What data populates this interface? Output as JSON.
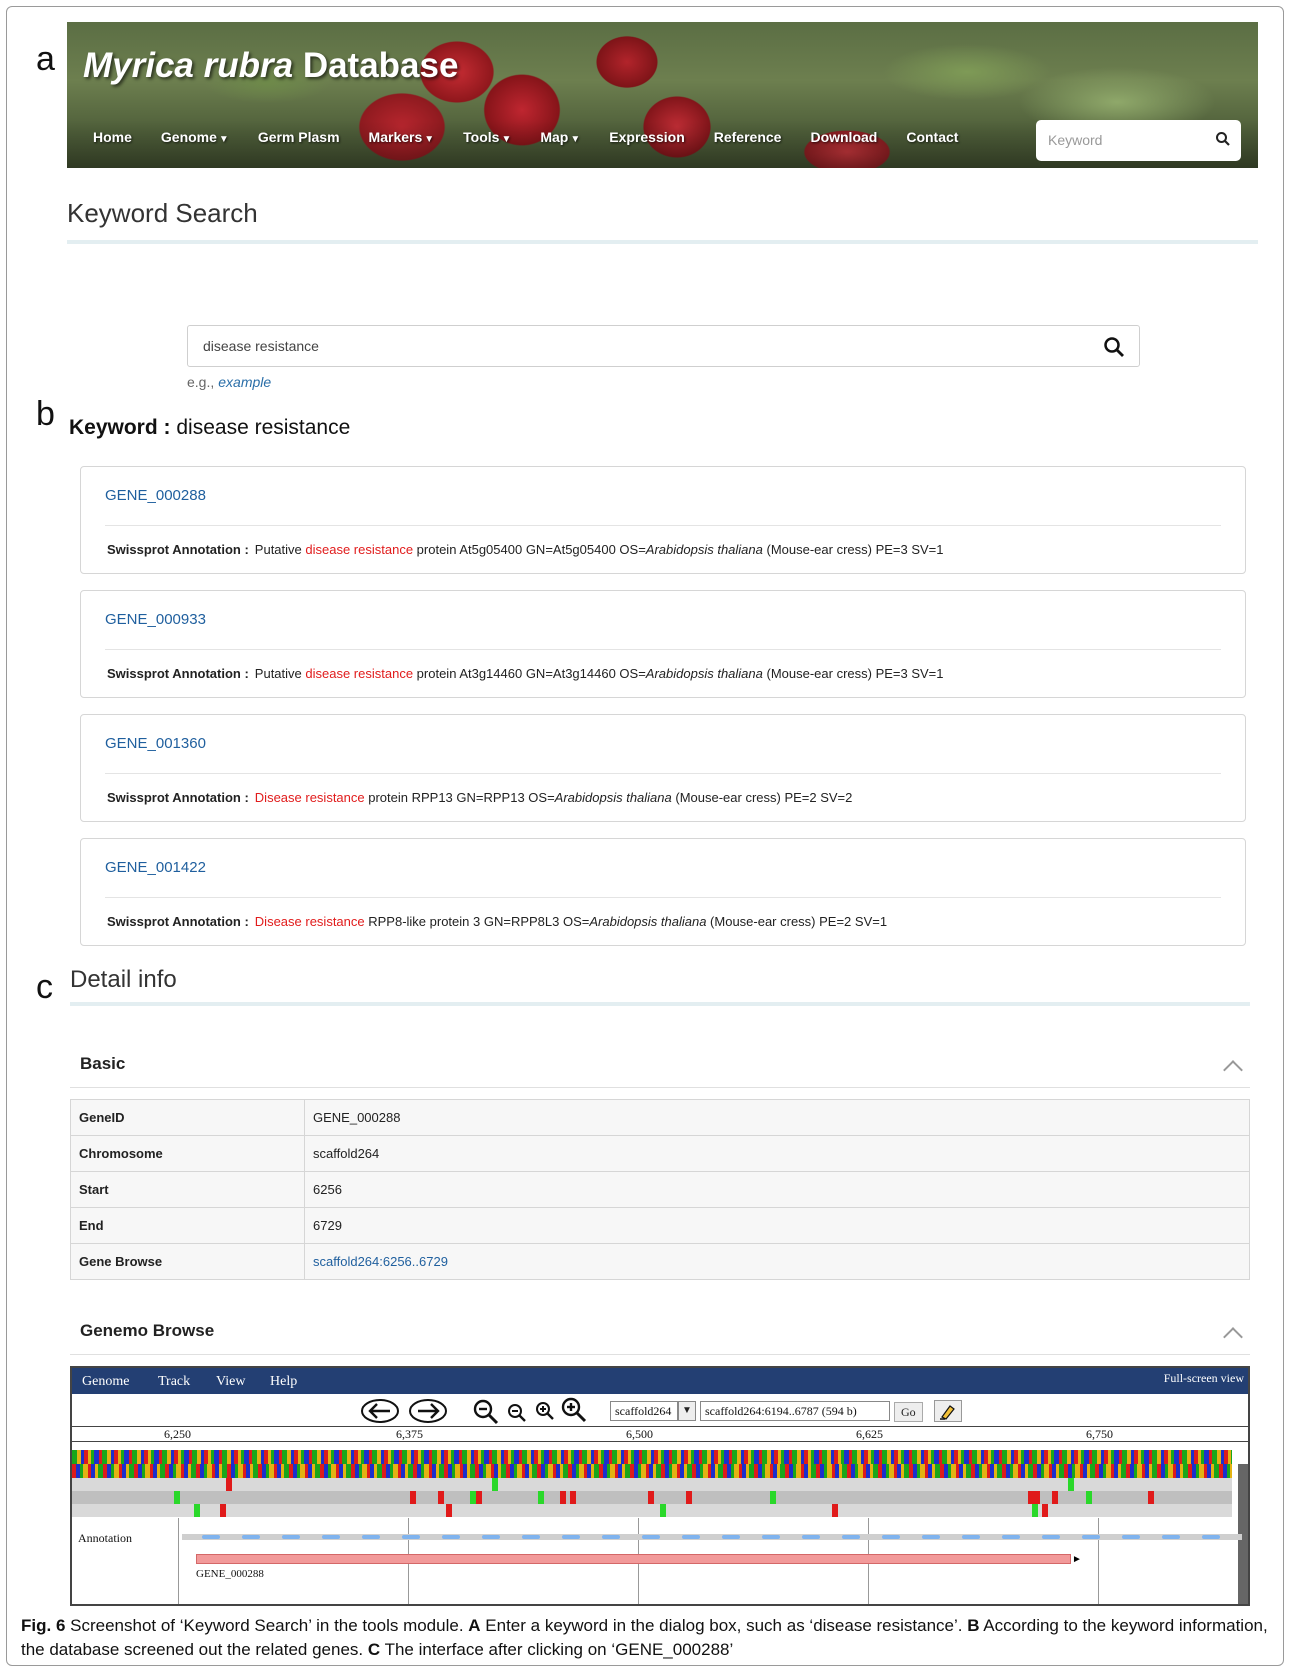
{
  "panels": {
    "a": "a",
    "b": "b",
    "c": "c"
  },
  "header": {
    "site_title_italic": "Myrica rubra",
    "site_title_rest": " Database",
    "nav": [
      "Home",
      "Genome",
      "Germ Plasm",
      "Markers",
      "Tools",
      "Map",
      "Expression",
      "Reference",
      "Download",
      "Contact"
    ],
    "search_placeholder": "Keyword"
  },
  "search_page": {
    "title": "Keyword Search",
    "query": "disease resistance",
    "eg_label": "e.g.,",
    "eg_link": "example"
  },
  "results": {
    "label": "Keyword :",
    "keyword": "disease resistance",
    "annotation_label": "Swissprot Annotation :",
    "items": [
      {
        "gene_id": "GENE_000288",
        "pre": "Putative ",
        "hl": "disease resistance",
        "mid": " protein At5g05400 GN=At5g05400 OS=",
        "species": "Arabidopsis thaliana",
        "post": " (Mouse-ear cress) PE=3 SV=1"
      },
      {
        "gene_id": "GENE_000933",
        "pre": "Putative ",
        "hl": "disease resistance",
        "mid": " protein At3g14460 GN=At3g14460 OS=",
        "species": "Arabidopsis thaliana",
        "post": " (Mouse-ear cress) PE=3 SV=1"
      },
      {
        "gene_id": "GENE_001360",
        "pre": "",
        "hl": "Disease resistance",
        "mid": " protein RPP13 GN=RPP13 OS=",
        "species": "Arabidopsis thaliana",
        "post": " (Mouse-ear cress) PE=2 SV=2"
      },
      {
        "gene_id": "GENE_001422",
        "pre": "",
        "hl": "Disease resistance",
        "mid": " RPP8-like protein 3 GN=RPP8L3 OS=",
        "species": "Arabidopsis thaliana",
        "post": " (Mouse-ear cress) PE=2 SV=1"
      }
    ]
  },
  "detail": {
    "title": "Detail info",
    "basic_title": "Basic",
    "rows": [
      {
        "key": "GeneID",
        "value": "GENE_000288"
      },
      {
        "key": "Chromosome",
        "value": "scaffold264"
      },
      {
        "key": "Start",
        "value": "6256"
      },
      {
        "key": "End",
        "value": "6729"
      },
      {
        "key": "Gene Browse",
        "value": "scaffold264:6256..6729"
      }
    ],
    "browse_title": "Genemo Browse"
  },
  "browser": {
    "menu": [
      "Genome",
      "Track",
      "View",
      "Help"
    ],
    "fullscreen": "Full-screen view",
    "ref_seq": "scaffold264",
    "location": "scaffold264:6194..6787 (594 b)",
    "go": "Go",
    "ticks": [
      "6,250",
      "6,375",
      "6,500",
      "6,625",
      "6,750"
    ],
    "track_label": "Annotation",
    "gene_label": "GENE_000288"
  },
  "caption": {
    "fig": "Fig. 6",
    "t1": "  Screenshot of ‘Keyword Search’ in the tools module. ",
    "A": "A",
    "t2": " Enter a keyword in the dialog box, such as ‘disease resistance’. ",
    "B": "B",
    "t3": " According to the keyword information, the database screened out the related genes. ",
    "C": "C",
    "t4": " The interface after clicking on ‘GENE_000288’"
  }
}
